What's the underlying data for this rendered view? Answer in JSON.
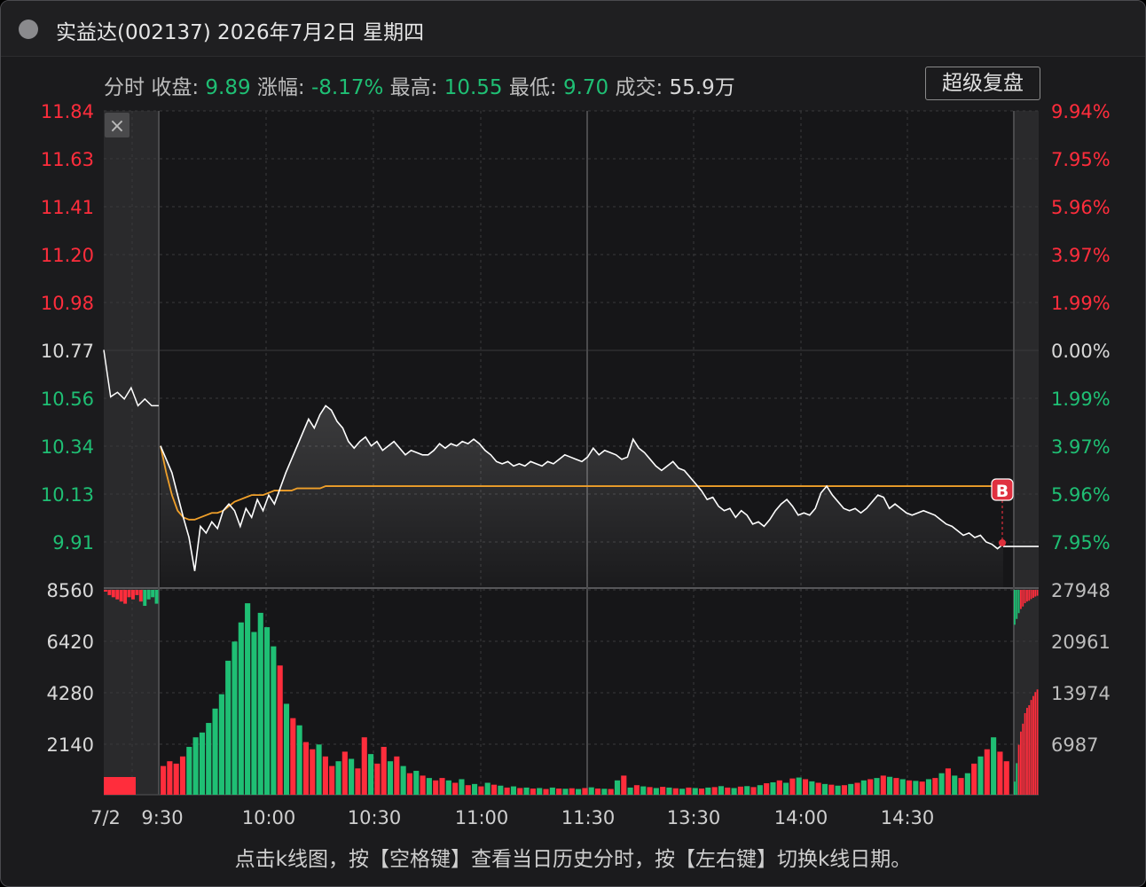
{
  "window": {
    "title": "实益达(002137) 2026年7月2日 星期四"
  },
  "info_bar": {
    "mode_label": "分时",
    "close_label": "收盘:",
    "close_value": "9.89",
    "change_label": "涨幅:",
    "change_value": "-8.17%",
    "high_label": "最高:",
    "high_value": "10.55",
    "low_label": "最低:",
    "low_value": "9.70",
    "volume_label": "成交:",
    "volume_value": "55.9万",
    "replay_button": "超级复盘"
  },
  "close_icon": "×",
  "price_axis_left": [
    "11.84",
    "11.63",
    "11.41",
    "11.20",
    "10.98",
    "10.77",
    "10.56",
    "10.34",
    "10.13",
    "9.91"
  ],
  "price_axis_right": [
    "9.94%",
    "7.95%",
    "5.96%",
    "3.97%",
    "1.99%",
    "0.00%",
    "1.99%",
    "3.97%",
    "5.96%",
    "7.95%"
  ],
  "volume_axis_left": [
    "8560",
    "6420",
    "4280",
    "2140"
  ],
  "volume_axis_right": [
    "27948",
    "20961",
    "13974",
    "6987"
  ],
  "time_axis": [
    "7/2",
    "9:30",
    "10:00",
    "10:30",
    "11:00",
    "11:30",
    "13:30",
    "14:00",
    "14:30"
  ],
  "marker_label": "B",
  "colors": {
    "up": "#ff2d3c",
    "down": "#1fbf74",
    "price_line": "#ffffff",
    "avg_line": "#f0a02a",
    "grid": "#3a3a3c",
    "background": "#1b1b1d"
  },
  "chart_data": {
    "type": "line",
    "price_range": [
      9.91,
      11.84
    ],
    "prev_close": 10.77,
    "price_series_pre": [
      10.77,
      10.56,
      10.58,
      10.55,
      10.6,
      10.52,
      10.55,
      10.52
    ],
    "price_series": [
      10.34,
      10.28,
      10.22,
      10.12,
      10.02,
      9.93,
      9.78,
      9.98,
      9.95,
      10.0,
      9.97,
      10.05,
      10.08,
      10.05,
      9.98,
      10.06,
      10.02,
      10.1,
      10.05,
      10.12,
      10.08,
      10.15,
      10.22,
      10.28,
      10.34,
      10.4,
      10.46,
      10.42,
      10.48,
      10.52,
      10.5,
      10.45,
      10.42,
      10.36,
      10.33,
      10.36,
      10.38,
      10.34,
      10.36,
      10.32,
      10.34,
      10.36,
      10.33,
      10.3,
      10.32,
      10.31,
      10.3,
      10.3,
      10.32,
      10.35,
      10.33,
      10.35,
      10.34,
      10.36,
      10.35,
      10.37,
      10.35,
      10.32,
      10.3,
      10.27,
      10.26,
      10.27,
      10.25,
      10.26,
      10.25,
      10.27,
      10.26,
      10.25,
      10.27,
      10.26,
      10.28,
      10.3,
      10.29,
      10.28,
      10.27,
      10.29,
      10.33,
      10.3,
      10.32,
      10.31,
      10.3,
      10.28,
      10.29,
      10.37,
      10.33,
      10.31,
      10.28,
      10.25,
      10.23,
      10.25,
      10.27,
      10.24,
      10.23,
      10.2,
      10.17,
      10.14,
      10.1,
      10.11,
      10.07,
      10.05,
      10.06,
      10.02,
      10.05,
      10.03,
      9.99,
      10.0,
      9.98,
      10.01,
      10.05,
      10.08,
      10.1,
      10.07,
      10.03,
      10.04,
      10.03,
      10.06,
      10.13,
      10.16,
      10.12,
      10.09,
      10.06,
      10.05,
      10.06,
      10.04,
      10.06,
      10.09,
      10.12,
      10.11,
      10.06,
      10.08,
      10.06,
      10.04,
      10.03,
      10.04,
      10.05,
      10.04,
      10.03,
      10.01,
      9.99,
      9.98,
      9.96,
      9.94,
      9.95,
      9.93,
      9.94,
      9.91,
      9.9,
      9.88,
      9.9
    ],
    "avg_series": [
      10.34,
      10.22,
      10.12,
      10.05,
      10.02,
      10.01,
      10.01,
      10.02,
      10.03,
      10.04,
      10.04,
      10.05,
      10.07,
      10.09,
      10.1,
      10.11,
      10.12,
      10.12,
      10.12,
      10.13,
      10.14,
      10.14,
      10.14,
      10.14,
      10.15,
      10.15,
      10.15,
      10.15,
      10.15,
      10.16,
      10.16,
      10.16,
      10.16,
      10.16,
      10.16,
      10.16,
      10.16,
      10.16,
      10.16,
      10.16,
      10.16,
      10.16,
      10.16,
      10.16,
      10.16,
      10.16,
      10.16,
      10.16,
      10.16,
      10.16,
      10.16,
      10.16,
      10.16,
      10.16,
      10.16,
      10.16,
      10.16,
      10.16,
      10.16,
      10.16,
      10.16,
      10.16,
      10.16,
      10.16,
      10.16,
      10.16,
      10.16,
      10.16,
      10.16,
      10.16,
      10.16,
      10.16,
      10.16,
      10.16,
      10.16,
      10.16,
      10.16,
      10.16,
      10.16,
      10.16,
      10.16,
      10.16,
      10.16,
      10.16,
      10.16,
      10.16,
      10.16,
      10.16,
      10.16,
      10.16,
      10.16,
      10.16,
      10.16,
      10.16,
      10.16,
      10.16,
      10.16,
      10.16,
      10.16,
      10.16,
      10.16,
      10.16,
      10.16,
      10.16,
      10.16,
      10.16,
      10.16,
      10.16,
      10.16,
      10.16,
      10.16,
      10.16,
      10.16,
      10.16,
      10.16,
      10.16,
      10.16,
      10.16,
      10.16,
      10.16,
      10.16,
      10.16,
      10.16,
      10.16,
      10.16,
      10.16,
      10.16,
      10.16,
      10.16,
      10.16,
      10.16,
      10.16,
      10.16,
      10.16,
      10.16,
      10.16,
      10.16,
      10.16,
      10.16,
      10.16,
      10.16,
      10.16,
      10.16,
      10.16,
      10.16,
      10.16,
      10.16
    ],
    "volume_range": [
      0,
      8560
    ],
    "volume_series": [
      1200,
      1400,
      1300,
      1600,
      2000,
      2400,
      2600,
      3000,
      3600,
      4200,
      5600,
      6400,
      7200,
      8000,
      6800,
      7600,
      7000,
      6200,
      5400,
      3800,
      3200,
      2900,
      2200,
      1900,
      2100,
      1600,
      1200,
      1400,
      1800,
      1500,
      1100,
      2400,
      1700,
      1300,
      2000,
      1400,
      1600,
      1200,
      900,
      1000,
      800,
      700,
      600,
      700,
      600,
      500,
      650,
      400,
      450,
      350,
      500,
      420,
      380,
      300,
      350,
      280,
      300,
      260,
      280,
      240,
      300,
      260,
      250,
      270,
      240,
      280,
      310,
      260,
      250,
      240,
      600,
      800,
      300,
      400,
      350,
      320,
      280,
      330,
      300,
      270,
      250,
      300,
      280,
      260,
      300,
      320,
      360,
      300,
      280,
      340,
      360,
      320,
      400,
      480,
      520,
      600,
      500,
      680,
      720,
      650,
      560,
      500,
      450,
      420,
      380,
      400,
      450,
      500,
      600,
      650,
      700,
      800,
      750,
      700,
      650,
      600,
      580,
      550,
      650,
      700,
      900,
      1100,
      800,
      700,
      900,
      1300,
      1600,
      1900,
      2400,
      1800,
      1400
    ],
    "volume_colors": [
      "up",
      "up",
      "up",
      "up",
      "down",
      "down",
      "down",
      "down",
      "down",
      "down",
      "down",
      "down",
      "down",
      "down",
      "down",
      "down",
      "down",
      "down",
      "up",
      "down",
      "up",
      "down",
      "up",
      "up",
      "down",
      "up",
      "up",
      "down",
      "up",
      "down",
      "up",
      "up",
      "down",
      "up",
      "up",
      "down",
      "up",
      "down",
      "up",
      "down",
      "up",
      "down",
      "up",
      "up",
      "down",
      "up",
      "down",
      "up",
      "down",
      "up",
      "down",
      "up",
      "down",
      "up",
      "down",
      "up",
      "down",
      "up",
      "down",
      "up",
      "down",
      "up",
      "down",
      "up",
      "down",
      "up",
      "down",
      "up",
      "down",
      "up",
      "down",
      "up",
      "down",
      "up",
      "down",
      "up",
      "down",
      "up",
      "down",
      "up",
      "down",
      "up",
      "down",
      "up",
      "down",
      "up",
      "down",
      "up",
      "down",
      "up",
      "down",
      "up",
      "down",
      "up",
      "down",
      "up",
      "down",
      "up",
      "down",
      "up",
      "down",
      "up",
      "down",
      "up",
      "down",
      "up",
      "down",
      "up",
      "down",
      "up",
      "down",
      "up",
      "down",
      "up",
      "down",
      "up",
      "down",
      "up",
      "down",
      "up",
      "down",
      "up",
      "down",
      "up",
      "down",
      "up",
      "down",
      "up",
      "down",
      "up",
      "up",
      "down",
      "up",
      "up",
      "up"
    ],
    "pre_volume_series": [
      8560,
      8400,
      8300,
      8200,
      8100,
      8000,
      8300,
      8200,
      8400,
      8100,
      7900,
      8200,
      8300,
      8000
    ],
    "post_volume_series": [
      1000,
      2400,
      3800,
      4800,
      5400,
      6200,
      6600,
      6800,
      7200,
      7500,
      7800,
      8000
    ]
  }
}
